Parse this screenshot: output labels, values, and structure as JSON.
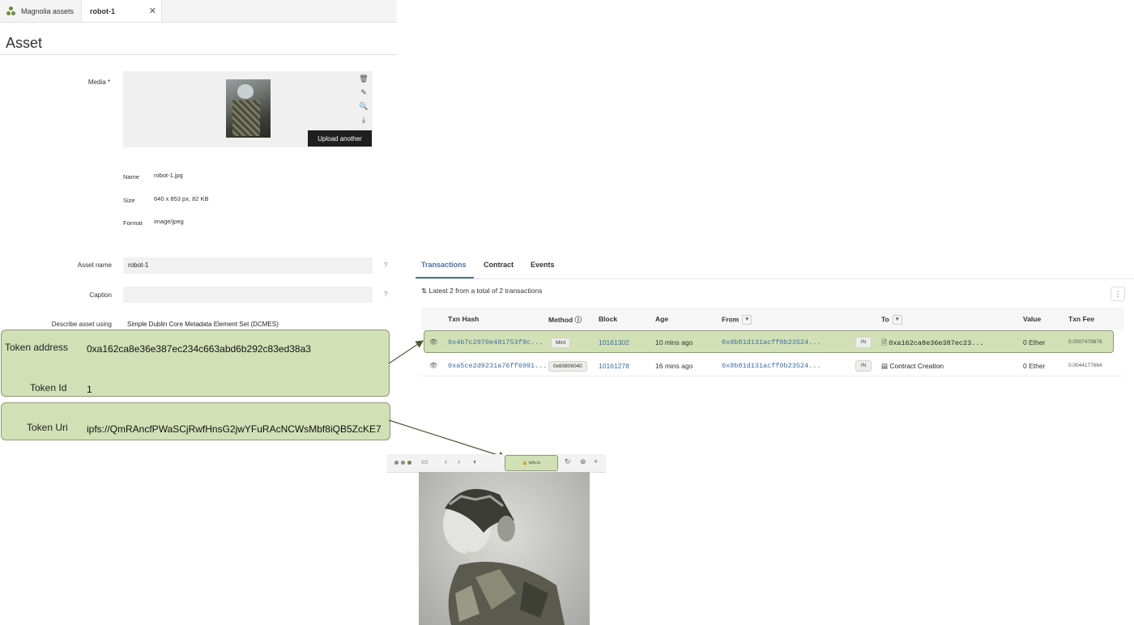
{
  "tabs": [
    {
      "label": "Magnolia assets",
      "icon": "magnolia-logo-icon"
    },
    {
      "label": "robot-1",
      "icon": "close-icon"
    }
  ],
  "page_title": "Asset",
  "form": {
    "media_label": "Media *",
    "upload_label": "Upload another",
    "media_actions": [
      "delete-icon",
      "edit-icon",
      "zoom-icon",
      "download-icon"
    ],
    "file_meta": [
      {
        "label": "Name",
        "value": "robot-1.jpg"
      },
      {
        "label": "Size",
        "value": "640 x 853 px, 82 KB"
      },
      {
        "label": "Format",
        "value": "image/jpeg"
      }
    ],
    "asset_name_label": "Asset name",
    "asset_name_value": "robot-1",
    "caption_label": "Caption",
    "caption_value": "",
    "help_mark": "?",
    "describe_label": "Describe asset using",
    "describe_value": "Simple Dublin Core Metadata Element Set (DCMES)"
  },
  "token": {
    "address_label": "Token address",
    "address_value": "0xa162ca8e36e387ec234c663abd6b292c83ed38a3",
    "id_label": "Token Id",
    "id_value": "1",
    "uri_label": "Token Uri",
    "uri_value": "ipfs://QmRAncfPWaSCjRwfHnsG2jwYFuRAcNCWsMbf8iQB5ZcKE7"
  },
  "explorer": {
    "tabs": [
      "Transactions",
      "Contract",
      "Events"
    ],
    "active_tab": "Transactions",
    "summary": "Latest 2 from a total of 2 transactions",
    "menu_icon": "⋮",
    "columns": [
      "Txn Hash",
      "Method",
      "Block",
      "Age",
      "From",
      "",
      "To",
      "Value",
      "Txn Fee"
    ],
    "rows": [
      {
        "hash": "0x4b7c2970e481753f9c...",
        "method": "Mint",
        "block": "10161302",
        "age": "10 mins ago",
        "from": "0x8b81d131acff0b23524...",
        "direction": "IN",
        "to": "0xa162ca8e36e387ec23...",
        "value": "0 Ether",
        "fee": "0.0007479876"
      },
      {
        "hash": "0xa5ce2d9231a76ff6991...",
        "method": "0x60806040",
        "block": "10161278",
        "age": "16 mins ago",
        "from": "0x8b81d131acff0b23524...",
        "direction": "IN",
        "to": "Contract Creation",
        "value": "0 Ether",
        "fee": "0.0044177664"
      }
    ]
  },
  "browser": {
    "url": "ipfs.io"
  },
  "colors": {
    "callout": "#d2e0b6",
    "callout_border": "#8a9a75",
    "link": "#3b6ea0",
    "upload_button": "#1f1f1f"
  }
}
